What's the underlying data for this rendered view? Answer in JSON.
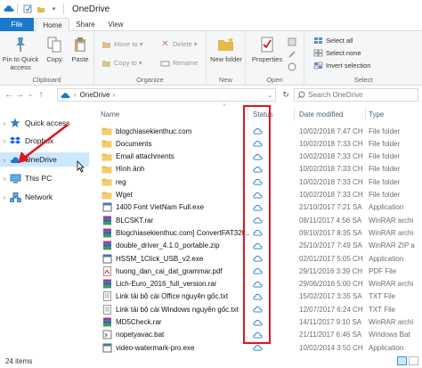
{
  "window": {
    "title": "OneDrive"
  },
  "colors": {
    "accent": "#1979ca",
    "highlight": "#e0141e",
    "selected": "#cce8ff",
    "folder": "#e8b84a"
  },
  "tabs": [
    {
      "label": "File"
    },
    {
      "label": "Home"
    },
    {
      "label": "Share"
    },
    {
      "label": "View"
    }
  ],
  "ribbon": {
    "clipboard": {
      "pin_label": "Pin to Quick access",
      "copy_label": "Copy",
      "paste_label": "Paste",
      "group_label": "Clipboard"
    },
    "organize": {
      "move_to": "Move to",
      "copy_to": "Copy to",
      "delete": "Delete",
      "rename": "Rename",
      "group_label": "Organize"
    },
    "new": {
      "new_folder": "New folder",
      "group_label": "New"
    },
    "open": {
      "properties": "Properties",
      "group_label": "Open"
    },
    "select": {
      "select_all": "Select all",
      "select_none": "Select none",
      "invert": "Invert selection",
      "group_label": "Select"
    }
  },
  "address": {
    "path": "OneDrive",
    "search_placeholder": "Search OneDrive"
  },
  "nav": {
    "items": [
      {
        "label": "Quick access",
        "icon": "star-icon"
      },
      {
        "label": "Dropbox",
        "icon": "dropbox-icon"
      },
      {
        "label": "OneDrive",
        "icon": "cloud-icon"
      },
      {
        "label": "This PC",
        "icon": "computer-icon"
      },
      {
        "label": "Network",
        "icon": "network-icon"
      }
    ]
  },
  "columns": {
    "name": "Name",
    "status": "Status",
    "date": "Date modified",
    "type": "Type"
  },
  "files": [
    {
      "name": "blogchiasekienthuc.com",
      "date": "10/02/2018 7:47 CH",
      "type": "File folder",
      "icon": "folder"
    },
    {
      "name": "Documents",
      "date": "10/02/2018 7:33 CH",
      "type": "File folder",
      "icon": "folder"
    },
    {
      "name": "Email attachments",
      "date": "10/02/2018 7:33 CH",
      "type": "File folder",
      "icon": "folder"
    },
    {
      "name": "Hình ảnh",
      "date": "10/02/2018 7:33 CH",
      "type": "File folder",
      "icon": "folder"
    },
    {
      "name": "reg",
      "date": "10/02/2018 7:33 CH",
      "type": "File folder",
      "icon": "folder"
    },
    {
      "name": "Wget",
      "date": "10/02/2018 7:33 CH",
      "type": "File folder",
      "icon": "folder"
    },
    {
      "name": "1400 Font VietNam Full.exe",
      "date": "21/10/2017 7:21 SA",
      "type": "Application",
      "icon": "exe"
    },
    {
      "name": "BLCSKT.rar",
      "date": "08/11/2017 4:56 SA",
      "type": "WinRAR archi",
      "icon": "rar"
    },
    {
      "name": "Blogchiasekienthuc.com] ConvertFAT32t...",
      "date": "09/10/2017 8:35 SA",
      "type": "WinRAR archi",
      "icon": "rar"
    },
    {
      "name": "double_driver_4.1.0_portable.zip",
      "date": "25/10/2017 7:49 SA",
      "type": "WinRAR ZIP a",
      "icon": "zip"
    },
    {
      "name": "HSSM_1Click_USB_v2.exe",
      "date": "02/01/2017 5:05 CH",
      "type": "Application",
      "icon": "exe"
    },
    {
      "name": "huong_dan_cai_dat_grammar.pdf",
      "date": "29/11/2016 3:39 CH",
      "type": "PDF File",
      "icon": "pdf"
    },
    {
      "name": "Lich-Euro_2016_full_version.rar",
      "date": "29/06/2016 5:00 CH",
      "type": "WinRAR archi",
      "icon": "rar"
    },
    {
      "name": "Link tải bộ cài Office nguyên gốc.txt",
      "date": "15/02/2017 3:35 SA",
      "type": "TXT File",
      "icon": "txt"
    },
    {
      "name": "Link tải bộ cài Windows nguyên gốc.txt",
      "date": "12/07/2017 6:24 CH",
      "type": "TXT File",
      "icon": "txt"
    },
    {
      "name": "MD5Check.rar",
      "date": "14/11/2017 9:10 SA",
      "type": "WinRAR archi",
      "icon": "rar"
    },
    {
      "name": "nopetyavac.bat",
      "date": "21/11/2017 6:46 SA",
      "type": "Windows Bat",
      "icon": "bat"
    },
    {
      "name": "video-watermark-pro.exe",
      "date": "10/02/2014 3:50 CH",
      "type": "Application",
      "icon": "exe"
    }
  ],
  "status": {
    "count": "24 items"
  }
}
